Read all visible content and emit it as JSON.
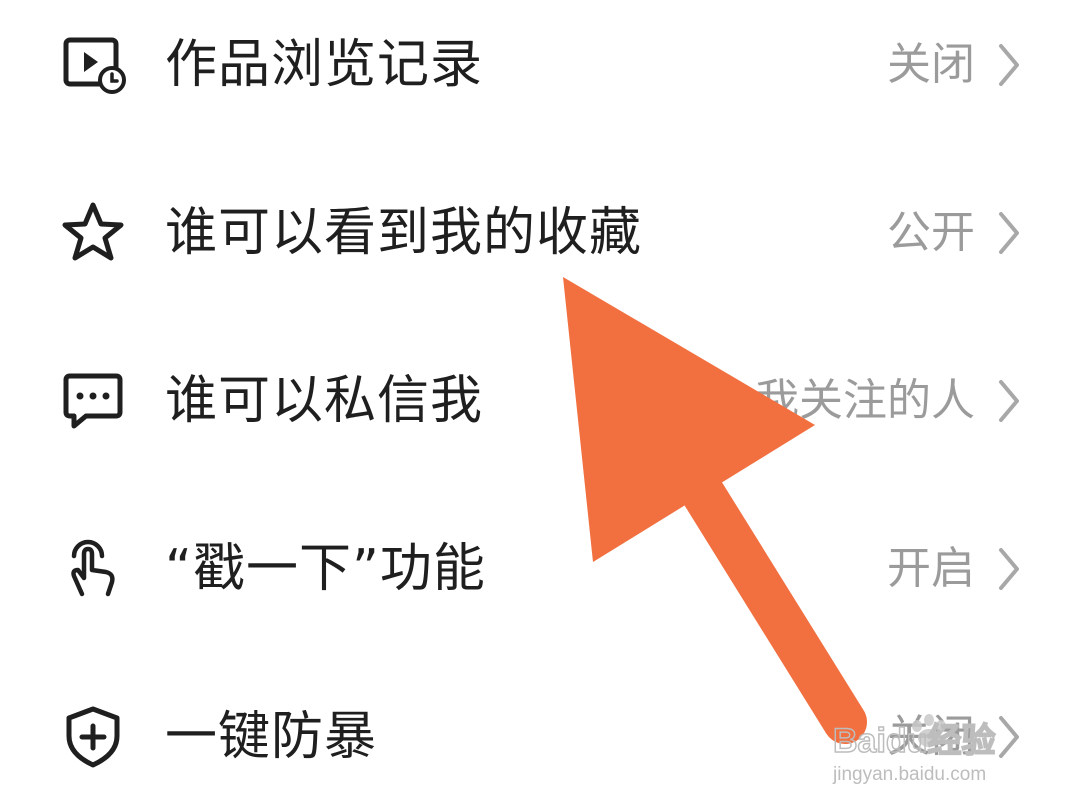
{
  "settings": {
    "items": [
      {
        "label": "作品浏览记录",
        "value": "关闭",
        "icon": "video-history-icon"
      },
      {
        "label": "谁可以看到我的收藏",
        "value": "公开",
        "icon": "star-icon"
      },
      {
        "label": "谁可以私信我",
        "value": "我关注的人",
        "icon": "message-icon"
      },
      {
        "label": "“戳一下”功能",
        "value": "开启",
        "icon": "tap-hand-icon"
      },
      {
        "label": "一键防暴",
        "value": "关闭",
        "icon": "shield-plus-icon"
      }
    ]
  },
  "annotation": {
    "arrow_color": "#f26f3f"
  },
  "watermark": {
    "brand": "Baidu经验",
    "url": "jingyan.baidu.com"
  }
}
